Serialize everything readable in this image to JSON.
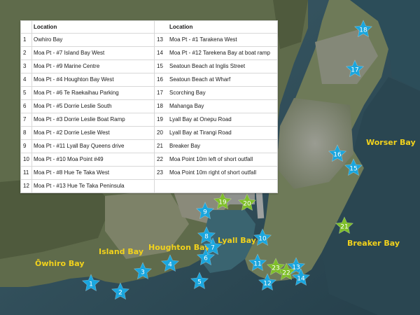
{
  "legend": {
    "header": "Location",
    "items": [
      {
        "num": "1",
        "label": "Owhiro Bay"
      },
      {
        "num": "2",
        "label": "Moa Pt - #7 Island Bay West"
      },
      {
        "num": "3",
        "label": "Moa Pt - #9 Marine Centre"
      },
      {
        "num": "4",
        "label": "Moa Pt - #4 Houghton Bay West"
      },
      {
        "num": "5",
        "label": "Moa Pt - #6 Te Raekaihau Parking"
      },
      {
        "num": "6",
        "label": "Moa Pt - #5 Dorrie Leslie South"
      },
      {
        "num": "7",
        "label": "Moa Pt - #3 Dorrie Leslie Boat Ramp"
      },
      {
        "num": "8",
        "label": "Moa Pt - #2 Dorrie Leslie West"
      },
      {
        "num": "9",
        "label": "Moa Pt - #11 Lyall Bay Queens drive"
      },
      {
        "num": "10",
        "label": "Moa Pt - #10 Moa Point #49"
      },
      {
        "num": "11",
        "label": "Moa Pt - #8 Hue Te Taka West"
      },
      {
        "num": "12",
        "label": "Moa Pt - #13 Hue Te Taka Peninsula"
      },
      {
        "num": "13",
        "label": "Moa Pt - #1 Tarakena West"
      },
      {
        "num": "14",
        "label": "Moa Pt - #12 Tarekena Bay at boat ramp"
      },
      {
        "num": "15",
        "label": "Seatoun Beach at Inglis Street"
      },
      {
        "num": "16",
        "label": "Seatoun Beach at Wharf"
      },
      {
        "num": "17",
        "label": "Scorching Bay"
      },
      {
        "num": "18",
        "label": "Mahanga Bay"
      },
      {
        "num": "19",
        "label": "Lyall Bay at Onepu Road"
      },
      {
        "num": "20",
        "label": "Lyall Bay at Tirangi Road"
      },
      {
        "num": "21",
        "label": "Breaker Bay"
      },
      {
        "num": "22",
        "label": "Moa Point 10m left of short outfall"
      },
      {
        "num": "23",
        "label": "Moa Point 10m right of short outfall"
      }
    ]
  },
  "places": {
    "worser_bay": "Worser Bay",
    "breaker_bay": "Breaker Bay",
    "lyall_bay": "Lyall Bay",
    "houghton_bay": "Houghton Bay",
    "island_bay": "Island Bay",
    "owhiro_bay": "Ōwhiro Bay"
  },
  "colors": {
    "marker_blue": "#1aa6de",
    "marker_green": "#7fbf2a",
    "place_label": "#f2d21c",
    "sea": "#2f4f5c",
    "land": "#6f7a5c"
  },
  "markers": [
    {
      "num": "1",
      "type": "blue"
    },
    {
      "num": "2",
      "type": "blue"
    },
    {
      "num": "3",
      "type": "blue"
    },
    {
      "num": "4",
      "type": "blue"
    },
    {
      "num": "5",
      "type": "blue"
    },
    {
      "num": "6",
      "type": "blue"
    },
    {
      "num": "7",
      "type": "blue"
    },
    {
      "num": "8",
      "type": "blue"
    },
    {
      "num": "9",
      "type": "blue"
    },
    {
      "num": "10",
      "type": "blue"
    },
    {
      "num": "11",
      "type": "blue"
    },
    {
      "num": "12",
      "type": "blue"
    },
    {
      "num": "13",
      "type": "blue"
    },
    {
      "num": "14",
      "type": "blue"
    },
    {
      "num": "15",
      "type": "blue"
    },
    {
      "num": "16",
      "type": "blue"
    },
    {
      "num": "17",
      "type": "blue"
    },
    {
      "num": "18",
      "type": "blue"
    },
    {
      "num": "19",
      "type": "green"
    },
    {
      "num": "20",
      "type": "green"
    },
    {
      "num": "21",
      "type": "green"
    },
    {
      "num": "22",
      "type": "green"
    },
    {
      "num": "23",
      "type": "green"
    }
  ]
}
